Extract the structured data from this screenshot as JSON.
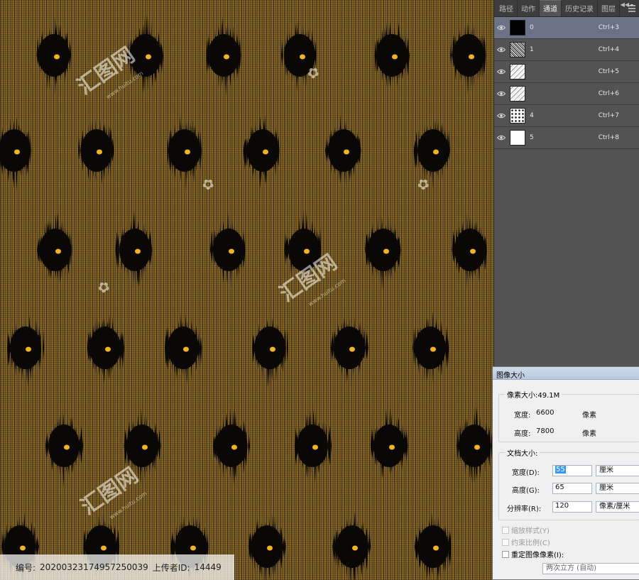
{
  "canvas": {
    "caption_id_label": "编号:",
    "caption_id_value": "20200323174957250039",
    "caption_uploader_label": "上传者ID:",
    "caption_uploader_value": "14449",
    "watermark_text": "汇图网",
    "watermark_url": "www.huitu.com",
    "colors": {
      "fabric": "#6e5418",
      "blot": "#0a0806",
      "dot": "#f4b41a"
    }
  },
  "channels_panel": {
    "tabs": [
      {
        "label": "路径"
      },
      {
        "label": "动作"
      },
      {
        "label": "通道",
        "active": true
      },
      {
        "label": "历史记录"
      },
      {
        "label": "图层"
      }
    ],
    "collapse_glyph": "◀◀",
    "channels": [
      {
        "name": "0",
        "shortcut": "Ctrl+3",
        "selected": true,
        "thumb": "black"
      },
      {
        "name": "1",
        "shortcut": "Ctrl+4",
        "selected": false,
        "thumb": "noise-dark"
      },
      {
        "name": "",
        "shortcut": "Ctrl+5",
        "selected": false,
        "thumb": "noise-light"
      },
      {
        "name": "",
        "shortcut": "Ctrl+6",
        "selected": false,
        "thumb": "noise-light"
      },
      {
        "name": "4",
        "shortcut": "Ctrl+7",
        "selected": false,
        "thumb": "dots"
      },
      {
        "name": "5",
        "shortcut": "Ctrl+8",
        "selected": false,
        "thumb": "white"
      }
    ]
  },
  "image_size_dialog": {
    "title": "图像大小",
    "pixel_dimensions": {
      "legend": "像素大小:49.1M",
      "width_label": "宽度:",
      "width_value": "6600",
      "width_unit": "像素",
      "height_label": "高度:",
      "height_value": "7800",
      "height_unit": "像素"
    },
    "document_size": {
      "legend": "文档大小:",
      "width_label": "宽度(D):",
      "width_value": "55",
      "width_unit": "厘米",
      "height_label": "高度(G):",
      "height_value": "65",
      "height_unit": "厘米",
      "resolution_label": "分辨率(R):",
      "resolution_value": "120",
      "resolution_unit": "像素/厘米"
    },
    "options": {
      "scale_styles": "缩放样式(Y)",
      "constrain_proportions": "约束比例(C)",
      "resample": "重定图像像素(I):",
      "resample_method": "两次立方 (自动)"
    }
  }
}
